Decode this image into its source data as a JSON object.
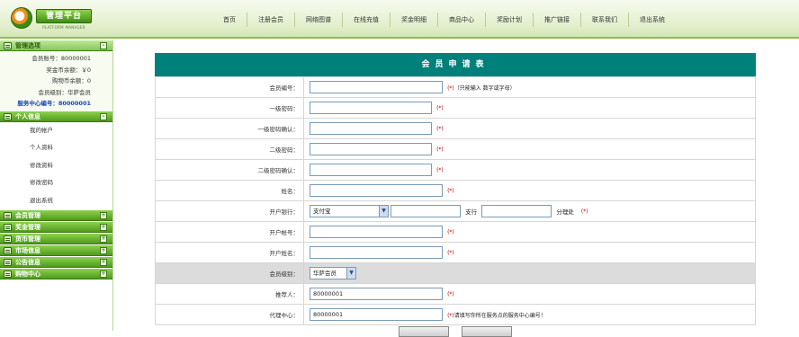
{
  "header": {
    "logo_text": "管理平台",
    "logo_sub": "PLATFORM MANAGER",
    "nav": [
      "首页",
      "注册会员",
      "网络图谱",
      "在线充值",
      "奖金明细",
      "商品中心",
      "奖励计划",
      "推广链接",
      "联系我们",
      "退出系统"
    ]
  },
  "sidebar": {
    "admin_title": "管理选项",
    "account": {
      "member_id": "会员账号：80000001",
      "bonus_balance": "奖金币余额：￥0",
      "shopping_balance": "购物币余额：0",
      "member_level": "会员级别：华萨会员",
      "service_center": "服务中心编号：80000001"
    },
    "personal_title": "个人信息",
    "personal_items": [
      "我的帐户",
      "个人资料",
      "修改资料",
      "修改密码",
      "退出系统"
    ],
    "sections": [
      "会员管理",
      "奖金管理",
      "货币管理",
      "市场信息",
      "公告信息",
      "购物中心"
    ]
  },
  "form": {
    "title": "会员申请表",
    "rows": {
      "member_no": {
        "label": "会员编号：",
        "hint": "(*)",
        "note": "（只能输入 数字或字母）"
      },
      "pwd1": {
        "label": "一级密码：",
        "hint": "(*)"
      },
      "pwd1_confirm": {
        "label": "一级密码确认：",
        "hint": "(*)"
      },
      "pwd2": {
        "label": "二级密码：",
        "hint": "(*)"
      },
      "pwd2_confirm": {
        "label": "二级密码确认：",
        "hint": "(*)"
      },
      "name": {
        "label": "姓名：",
        "hint": "(*)"
      },
      "bank": {
        "label": "开户银行：",
        "selected": "支付宝",
        "branch_label": "支行",
        "sub_label": "分理处",
        "hint": "(*)"
      },
      "bank_account": {
        "label": "开户帐号：",
        "hint": "(*)"
      },
      "bank_name": {
        "label": "开户姓名：",
        "hint": "(*)"
      },
      "level": {
        "label": "会员级别：",
        "selected": "华萨会员"
      },
      "referrer": {
        "label": "推荐人：",
        "value": "80000001",
        "hint": "(*)"
      },
      "center": {
        "label": "代理中心：",
        "value": "80000001",
        "hint": "(*)",
        "note": "请填写你所在服务点的服务中心编号！"
      }
    }
  }
}
